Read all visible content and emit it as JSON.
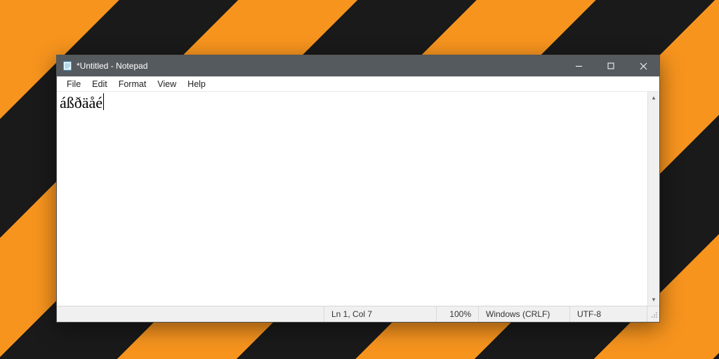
{
  "window": {
    "title": "*Untitled - Notepad"
  },
  "menu": {
    "file": "File",
    "edit": "Edit",
    "format": "Format",
    "view": "View",
    "help": "Help"
  },
  "editor": {
    "content": "áßðäåé"
  },
  "status": {
    "position": "Ln 1, Col 7",
    "zoom": "100%",
    "eol": "Windows (CRLF)",
    "encoding": "UTF-8"
  }
}
